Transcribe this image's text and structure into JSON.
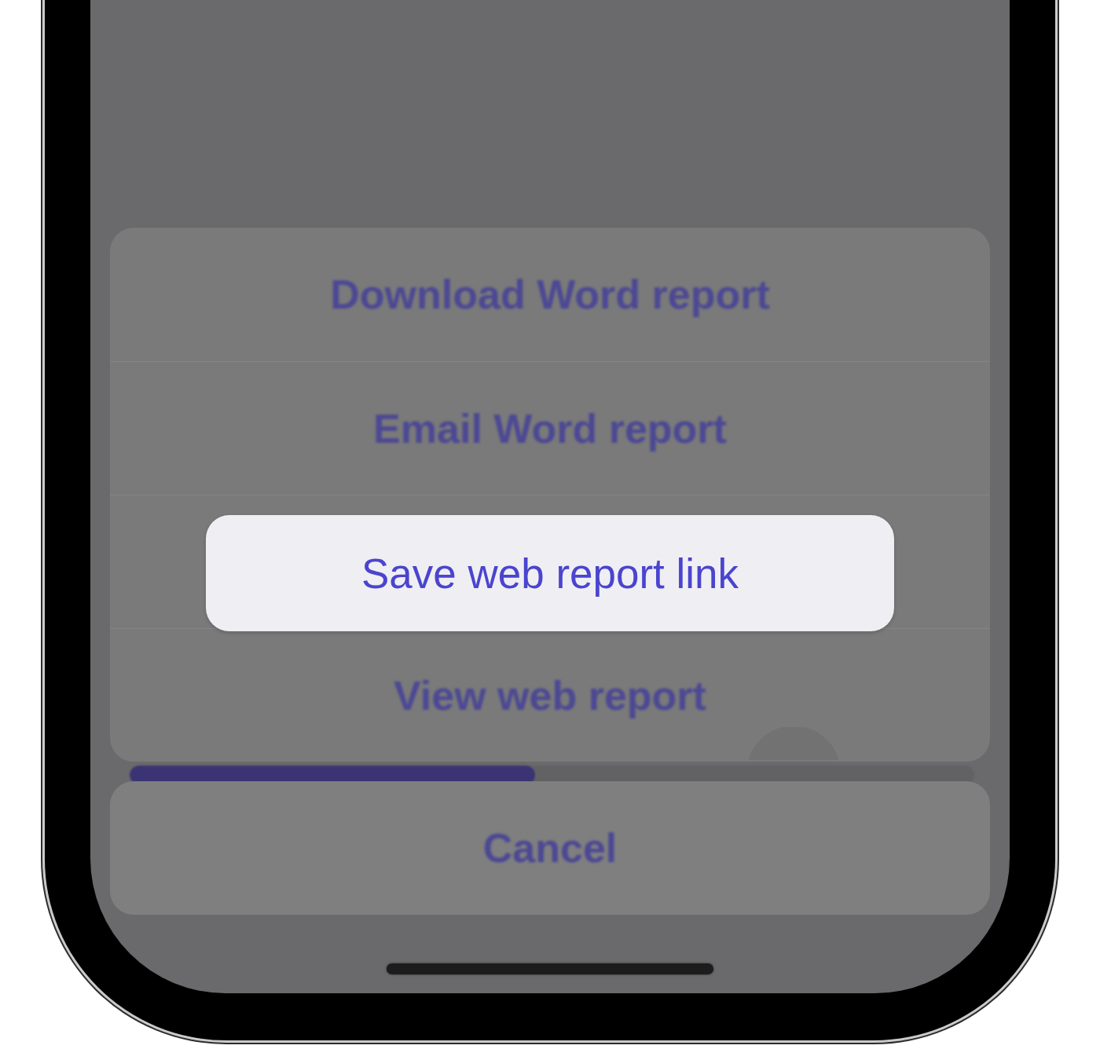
{
  "action_sheet": {
    "actions": [
      {
        "label": "Download Word report",
        "selected": false
      },
      {
        "label": "Email Word report",
        "selected": false
      },
      {
        "label": "Save web report link",
        "selected": true
      },
      {
        "label": "View web report",
        "selected": false
      }
    ]
  },
  "progress_bar": {
    "level": 0.48
  },
  "cancel_button": {
    "label": "Cancel"
  }
}
